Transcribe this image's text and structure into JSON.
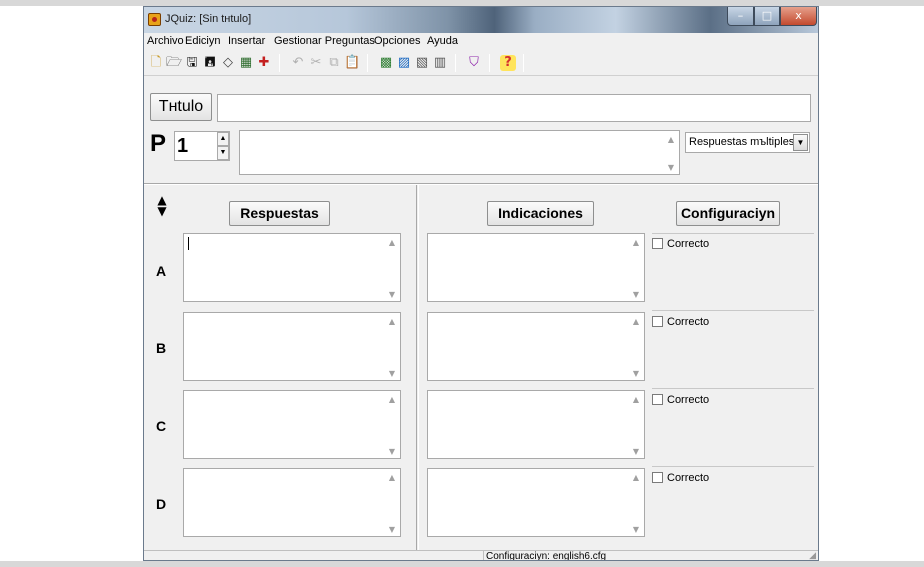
{
  "window": {
    "title": "JQuiz: [Sin tнtulo]",
    "controls": {
      "minimize": "–",
      "maximize": "□",
      "close": "x"
    }
  },
  "menu": [
    "Archivo",
    "Ediciуn",
    "Insertar",
    "Gestionar Preguntas",
    "Opciones",
    "Ayuda"
  ],
  "toolbar": {
    "icons": [
      "new-icon",
      "open-icon",
      "save-icon",
      "save-as-icon",
      "eraser-icon",
      "export-icon",
      "arrow-down-icon",
      "undo-icon",
      "cut-icon",
      "copy-icon",
      "paste-icon",
      "add-question-icon",
      "edit-question-icon",
      "add-answer-icon",
      "delete-answer-icon",
      "export-web-icon",
      "help-icon"
    ],
    "glyphs": [
      "🗋",
      "🗁",
      "🖫",
      "🖪",
      "◇",
      "▦",
      "✚",
      "↶",
      "✂",
      "⧉",
      "📋",
      "▩",
      "▨",
      "▧",
      "▥",
      "⛉",
      "?"
    ]
  },
  "header": {
    "title_button": "Tнtulo",
    "title_value": "",
    "question_label": "P",
    "question_number": "1",
    "question_text": "",
    "question_type": "Respuestas mъltiples"
  },
  "answers_panel": {
    "respuestas_button": "Respuestas",
    "indicaciones_button": "Indicaciones",
    "configuracion_button": "Configuraciуn",
    "rows": [
      {
        "label": "A",
        "answer": "",
        "feedback": "",
        "correct_label": "Correcto"
      },
      {
        "label": "B",
        "answer": "",
        "feedback": "",
        "correct_label": "Correcto"
      },
      {
        "label": "C",
        "answer": "",
        "feedback": "",
        "correct_label": "Correcto"
      },
      {
        "label": "D",
        "answer": "",
        "feedback": "",
        "correct_label": "Correcto"
      }
    ]
  },
  "status": {
    "config": "Configuraciуn: english6.cfg"
  }
}
